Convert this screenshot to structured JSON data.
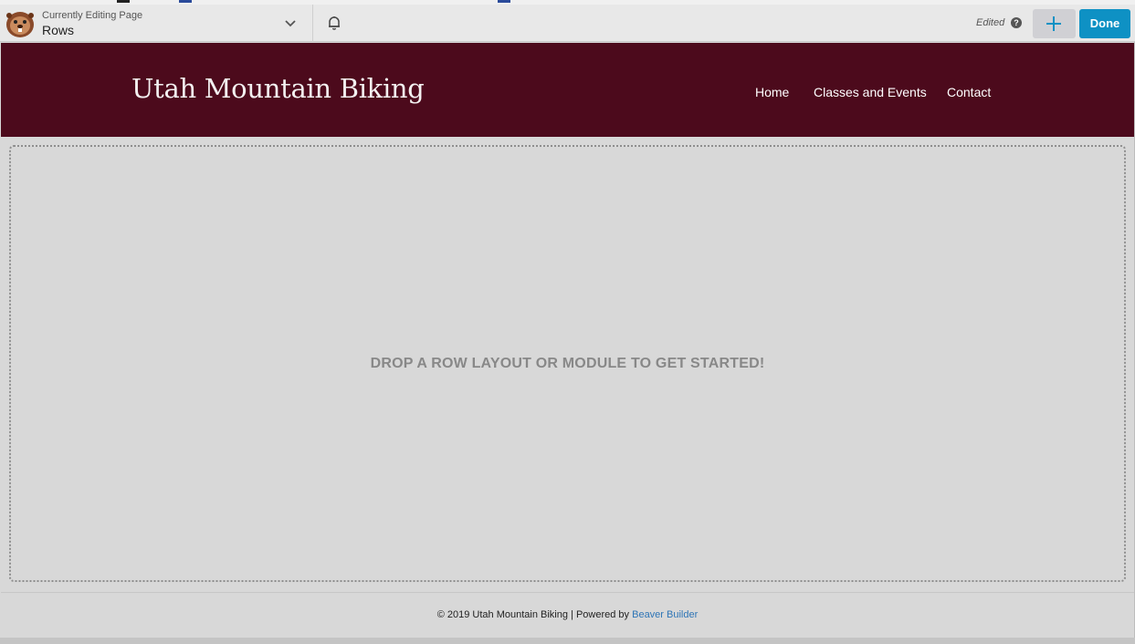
{
  "toolbar": {
    "editing_label": "Currently Editing Page",
    "page_name": "Rows",
    "status": "Edited",
    "help_glyph": "?",
    "done_label": "Done",
    "icons": {
      "logo": "beaver-logo",
      "dropdown": "chevron-down-icon",
      "notifications": "bell-icon",
      "add": "plus-icon",
      "help": "question-icon"
    },
    "colors": {
      "done": "#0e91c4",
      "add_plus": "#0e91c4"
    }
  },
  "site": {
    "title": "Utah Mountain Biking",
    "nav": [
      "Home",
      "Classes and Events",
      "Contact"
    ],
    "colors": {
      "header_bg": "#4c0a1c"
    }
  },
  "canvas": {
    "drop_message": "DROP A ROW LAYOUT OR MODULE TO GET STARTED!"
  },
  "footer": {
    "text": "© 2019 Utah Mountain Biking | Powered by",
    "link": "Beaver Builder",
    "colors": {
      "link": "#2e75b6"
    }
  }
}
